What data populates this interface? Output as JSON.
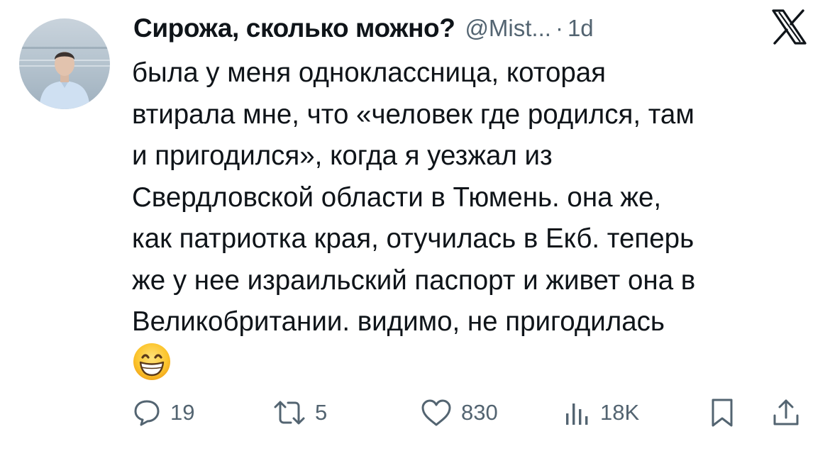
{
  "tweet": {
    "author": {
      "display_name": "Сирожа, сколько можно?",
      "handle": "@Mist...",
      "separator": "·",
      "time": "1d"
    },
    "text": "была у меня одноклассница, которая\nвтирала мне, что «человек где родился, там\nи пригодился», когда я уезжал из\nСвердловской области в Тюмень. она же,\nкак патриотка края, отучилась в Екб. теперь\nже у нее израильский паспорт и живет она в\nВеликобритании. видимо, не пригодилась",
    "emoji": "grinning-face-with-smiling-eyes",
    "actions": {
      "replies": "19",
      "reposts": "5",
      "likes": "830",
      "views": "18K"
    }
  },
  "icons": {
    "platform_logo": "x-logo",
    "reply": "reply-icon",
    "repost": "repost-icon",
    "like": "heart-icon",
    "views": "views-icon",
    "bookmark": "bookmark-icon",
    "share": "share-icon"
  },
  "colors": {
    "text": "#0f1419",
    "secondary": "#536471",
    "background": "#ffffff"
  }
}
